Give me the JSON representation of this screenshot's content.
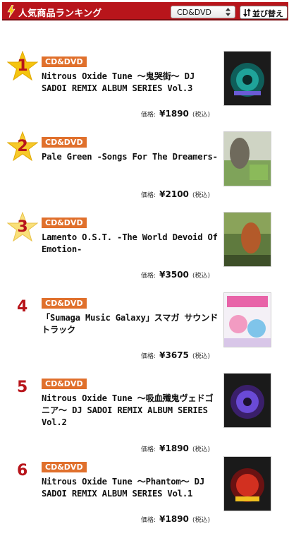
{
  "header": {
    "title": "人気商品ランキング",
    "category_select": {
      "selected": "CD&DVD"
    },
    "sort_button_label": "並び替え",
    "colors": {
      "brand_red": "#b8151b",
      "badge_orange": "#e0702c",
      "star_gold": "#f5c40f"
    }
  },
  "price_label": "価格:",
  "tax_label": "(税込)",
  "items": [
    {
      "rank": "1",
      "category": "CD&DVD",
      "title": "Nitrous Oxide Tune 〜鬼哭街〜 DJ SADOI REMIX ALBUM SERIES Vol.3",
      "price": "¥1890",
      "cover_icon": "album-cover-teal-emblem"
    },
    {
      "rank": "2",
      "category": "CD&DVD",
      "title": "Pale Green -Songs For The Dreamers-",
      "price": "¥2100",
      "cover_icon": "album-cover-green-illustration"
    },
    {
      "rank": "3",
      "category": "CD&DVD",
      "title": "Lamento O.S.T. -The World Devoid Of Emotion-",
      "price": "¥3500",
      "cover_icon": "album-cover-forest-illustration"
    },
    {
      "rank": "4",
      "category": "CD&DVD",
      "title": "「Sumaga Music Galaxy」スマガ サウンドトラック",
      "price": "¥3675",
      "cover_icon": "album-cover-anime-characters"
    },
    {
      "rank": "5",
      "category": "CD&DVD",
      "title": "Nitrous Oxide Tune 〜吸血殲鬼ヴェドゴニア〜 DJ SADOI REMIX ALBUM SERIES Vol.2",
      "price": "¥1890",
      "cover_icon": "album-cover-purple-emblem"
    },
    {
      "rank": "6",
      "category": "CD&DVD",
      "title": "Nitrous Oxide Tune 〜Phantom〜 DJ SADOI REMIX ALBUM SERIES Vol.1",
      "price": "¥1890",
      "cover_icon": "album-cover-red-emblem"
    }
  ]
}
